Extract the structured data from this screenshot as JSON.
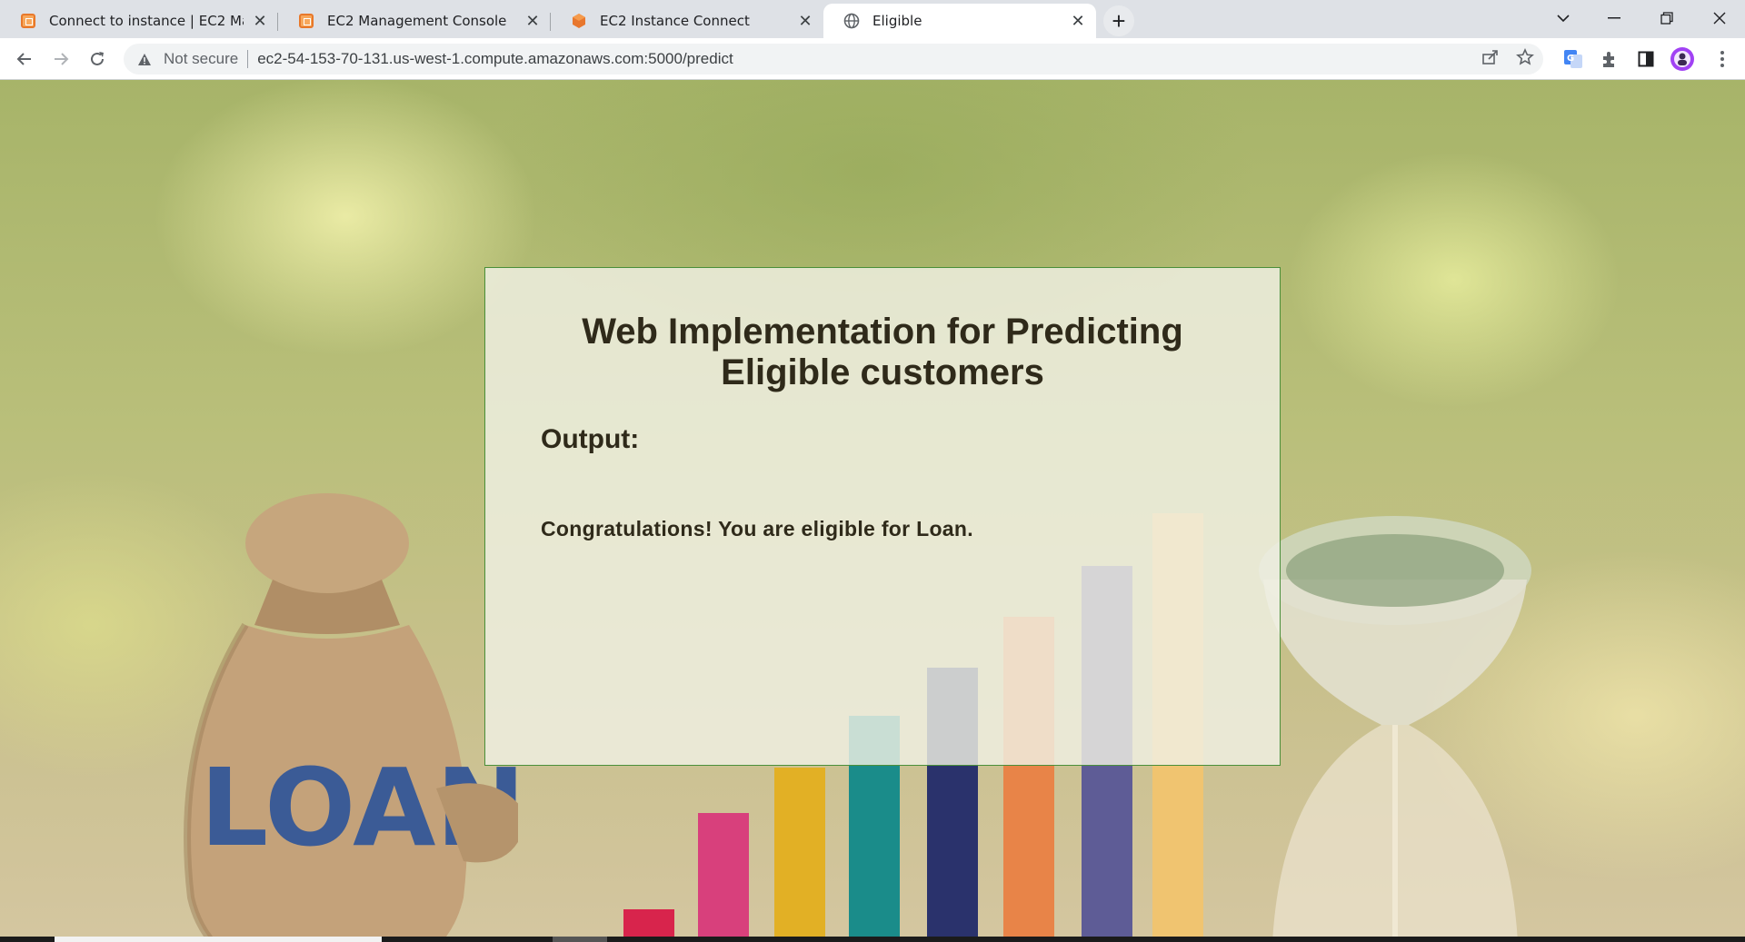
{
  "tabs": [
    {
      "title": "Connect to instance | EC2 Manag",
      "favicon": "aws-console-icon"
    },
    {
      "title": "EC2 Management Console",
      "favicon": "aws-console-icon"
    },
    {
      "title": "EC2 Instance Connect",
      "favicon": "aws-cube-icon"
    },
    {
      "title": "Eligible",
      "favicon": "globe-icon",
      "active": true
    }
  ],
  "address_bar": {
    "security_label": "Not secure",
    "url": "ec2-54-153-70-131.us-west-1.compute.amazonaws.com:5000/predict"
  },
  "page": {
    "heading_line1": "Web Implementation for Predicting",
    "heading_line2": "Eligible customers",
    "output_label": "Output:",
    "result_text": "Congratulations! You are eligible for Loan."
  },
  "background": {
    "bag_text": "LOAN"
  },
  "colors": {
    "card_border": "#4a8f3a",
    "heading_text": "#2f2a1a",
    "tab_strip": "#dee1e6"
  }
}
